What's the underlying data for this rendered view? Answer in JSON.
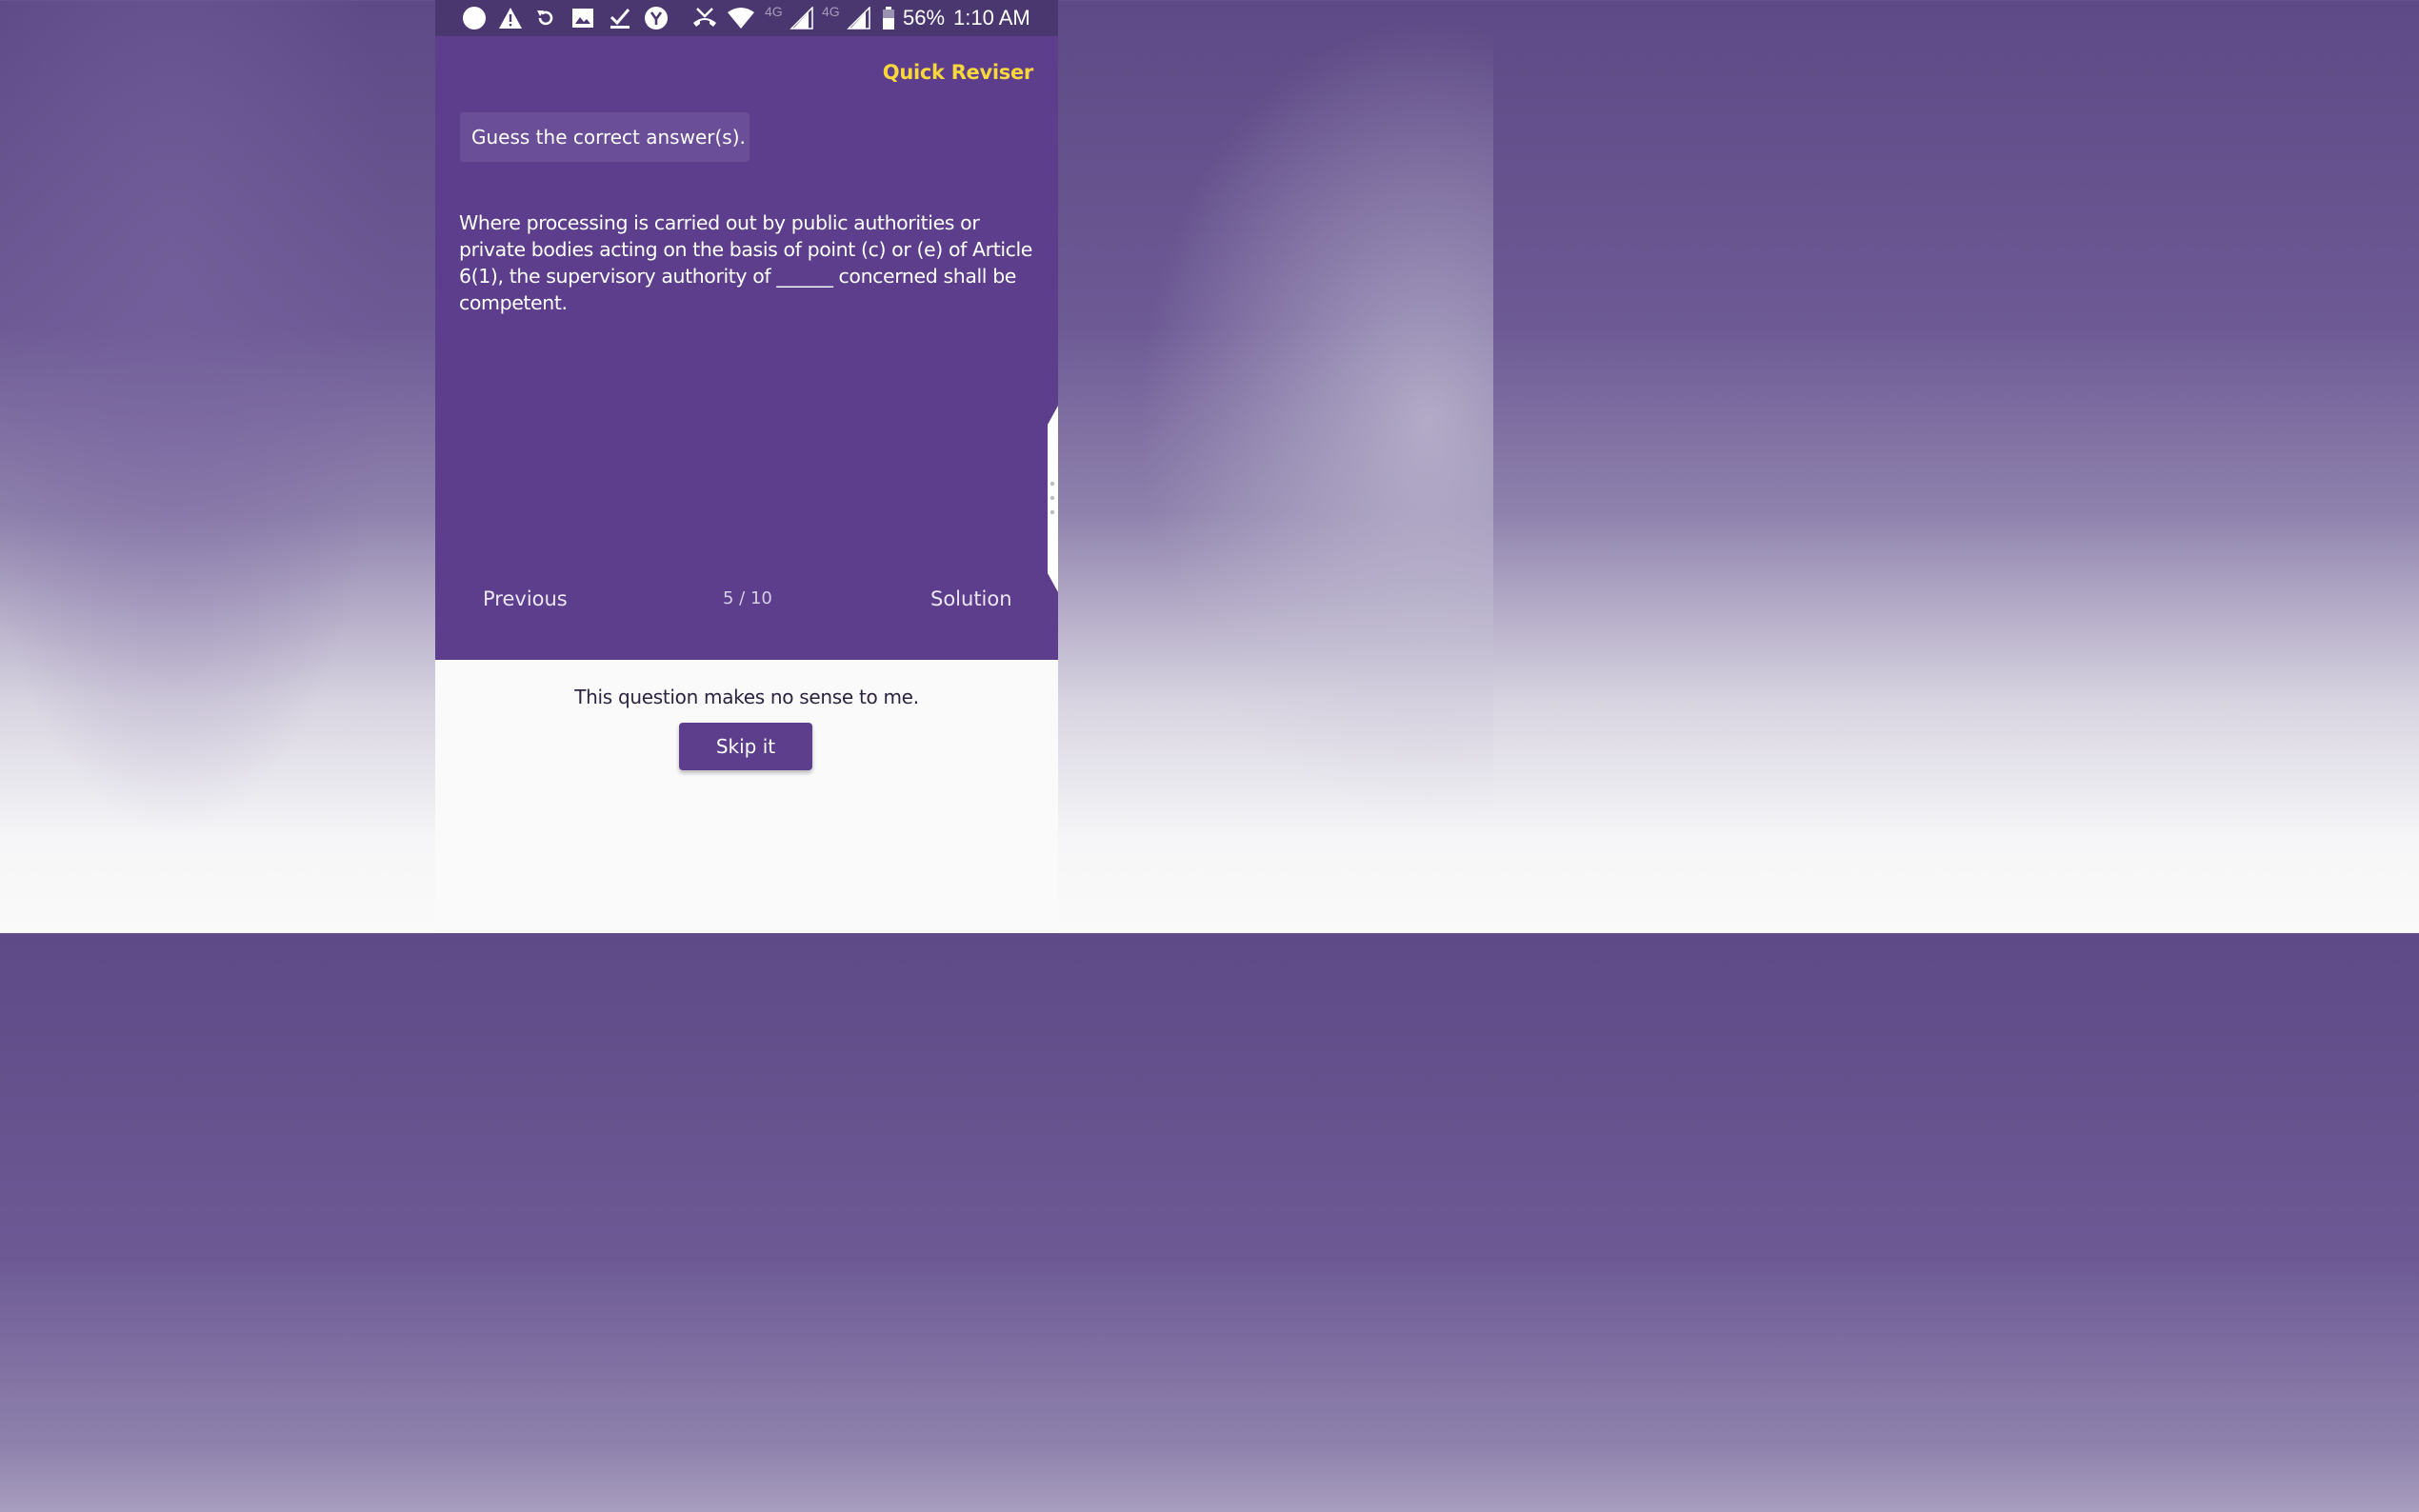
{
  "status_bar": {
    "network_1": "4G",
    "network_2": "4G",
    "battery": "56%",
    "time": "1:10 AM",
    "icons": [
      "circle-icon",
      "warning-icon",
      "sync-icon",
      "image-icon",
      "checkmark-icon",
      "y-badge-icon",
      "missed-call-icon",
      "wifi-icon",
      "signal-icon",
      "signal-icon",
      "battery-icon"
    ]
  },
  "header": {
    "brand": "Quick Reviser",
    "brand_color": "#f7d73b"
  },
  "quiz": {
    "instruction": "Guess the correct answer(s).",
    "question": "Where processing is carried out by public authorities or private bodies acting on the basis of point (c) or (e) of Article 6(1), the supervisory authority of ______ concerned shall be competent.",
    "previous_label": "Previous",
    "progress": "5 / 10",
    "solution_label": "Solution",
    "card_color": "#5c3e8c"
  },
  "footer": {
    "message": "This question makes no sense to me.",
    "skip_label": "Skip it"
  }
}
